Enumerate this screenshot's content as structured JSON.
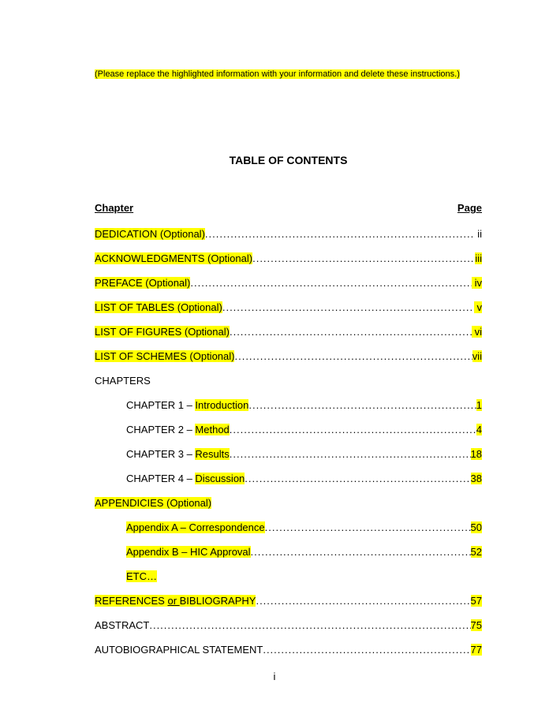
{
  "instruction": "(Please replace the highlighted information with your information and delete these instructions.)",
  "title": "TABLE OF CONTENTS",
  "header": {
    "left": "Chapter",
    "right": "Page"
  },
  "entries": {
    "dedication": {
      "label": "DEDICATION (Optional)",
      "page": "ii"
    },
    "acknowledgments": {
      "label": "ACKNOWLEDGMENTS (Optional)",
      "page": "iii"
    },
    "preface": {
      "label": "PREFACE (Optional)",
      "page": "iv"
    },
    "lot": {
      "label": "LIST OF TABLES (Optional)",
      "page": "v"
    },
    "lof": {
      "label": "LIST OF FIGURES (Optional)",
      "page": "vi"
    },
    "los": {
      "label": "LIST OF SCHEMES (Optional)",
      "page": "vii"
    },
    "chapters_heading": "CHAPTERS",
    "ch1": {
      "prefix": "CHAPTER 1 – ",
      "title": "Introduction",
      "page": "1"
    },
    "ch2": {
      "prefix": "CHAPTER 2 – ",
      "title": "Method",
      "page": "4"
    },
    "ch3": {
      "prefix": "CHAPTER 3 – ",
      "title": "Results",
      "page": "18"
    },
    "ch4": {
      "prefix": "CHAPTER 4 – ",
      "title": "Discussion",
      "page": "38"
    },
    "appendices_heading": "APPENDICIES (Optional)",
    "appA": {
      "label": "Appendix A – Correspondence",
      "page": "50"
    },
    "appB": {
      "label": "Appendix B – HIC Approval",
      "page": "52"
    },
    "etc": "ETC…",
    "references": {
      "prefix": "REFERENCES ",
      "mid": " or ",
      "suffix": " BIBLIOGRAPHY",
      "page": "57"
    },
    "abstract": {
      "label": "ABSTRACT",
      "page": "75"
    },
    "autobio": {
      "label": "AUTOBIOGRAPHICAL STATEMENT",
      "page": "77"
    }
  },
  "page_number": "i"
}
